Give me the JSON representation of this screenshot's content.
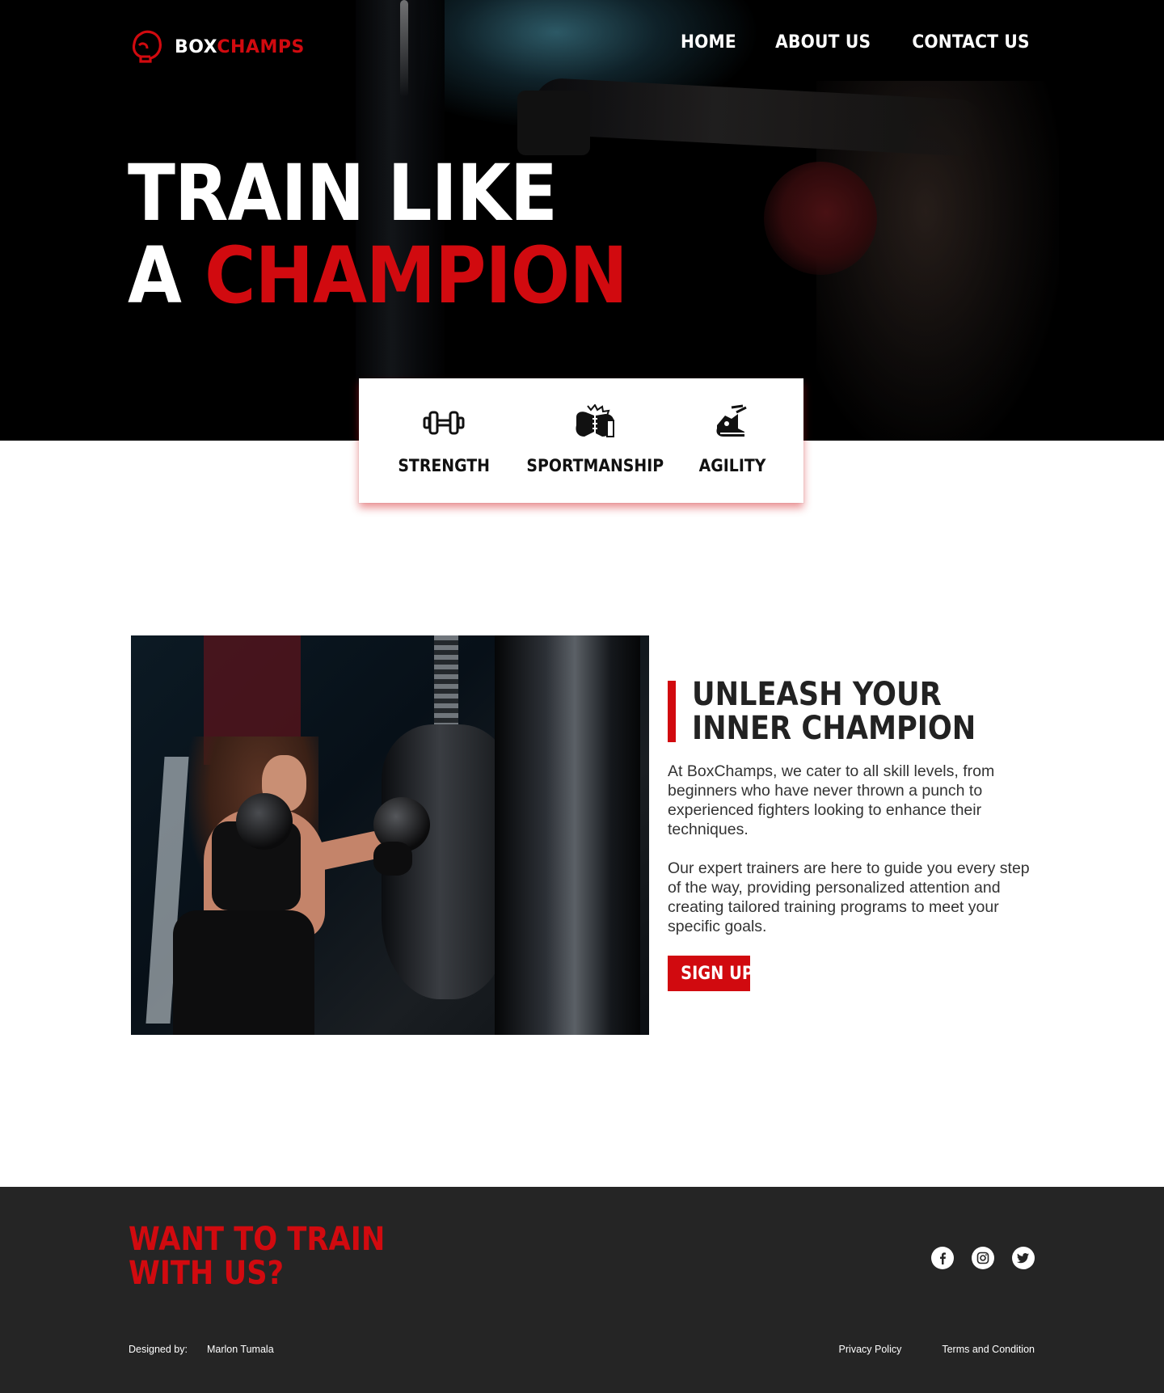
{
  "brand": {
    "part1": "BOX",
    "part2": "CHAMPS",
    "accent": "#d10a0f"
  },
  "nav": [
    {
      "label": "HOME"
    },
    {
      "label": "ABOUT US"
    },
    {
      "label": "CONTACT US"
    }
  ],
  "hero": {
    "line1": "TRAIN LIKE",
    "line2_prefix": "A ",
    "line2_accent": "CHAMPION"
  },
  "features": [
    {
      "icon": "dumbbell-icon",
      "label": "STRENGTH"
    },
    {
      "icon": "handshake-glove-icon",
      "label": "SPORTMANSHIP"
    },
    {
      "icon": "running-shoe-icon",
      "label": "AGILITY"
    }
  ],
  "about": {
    "heading_line1": "UNLEASH YOUR",
    "heading_line2": "INNER CHAMPION",
    "paragraph1": "At BoxChamps, we cater to all skill levels, from beginners who have never thrown a punch to experienced fighters looking to enhance their techniques.",
    "paragraph2": "Our expert trainers are here to guide you every step of the way, providing personalized attention and creating tailored training programs to meet your specific goals.",
    "cta": "SIGN UP"
  },
  "footer": {
    "cta_line1": "WANT TO TRAIN",
    "cta_line2": "WITH US?",
    "socials": [
      "facebook-icon",
      "instagram-icon",
      "twitter-icon"
    ],
    "designed_by_label": "Designed by:",
    "designer": "Marlon Tumala",
    "privacy": "Privacy Policy",
    "terms": "Terms and Condition"
  },
  "colors": {
    "footer_bg": "#252525",
    "hero_bg": "#000000"
  }
}
